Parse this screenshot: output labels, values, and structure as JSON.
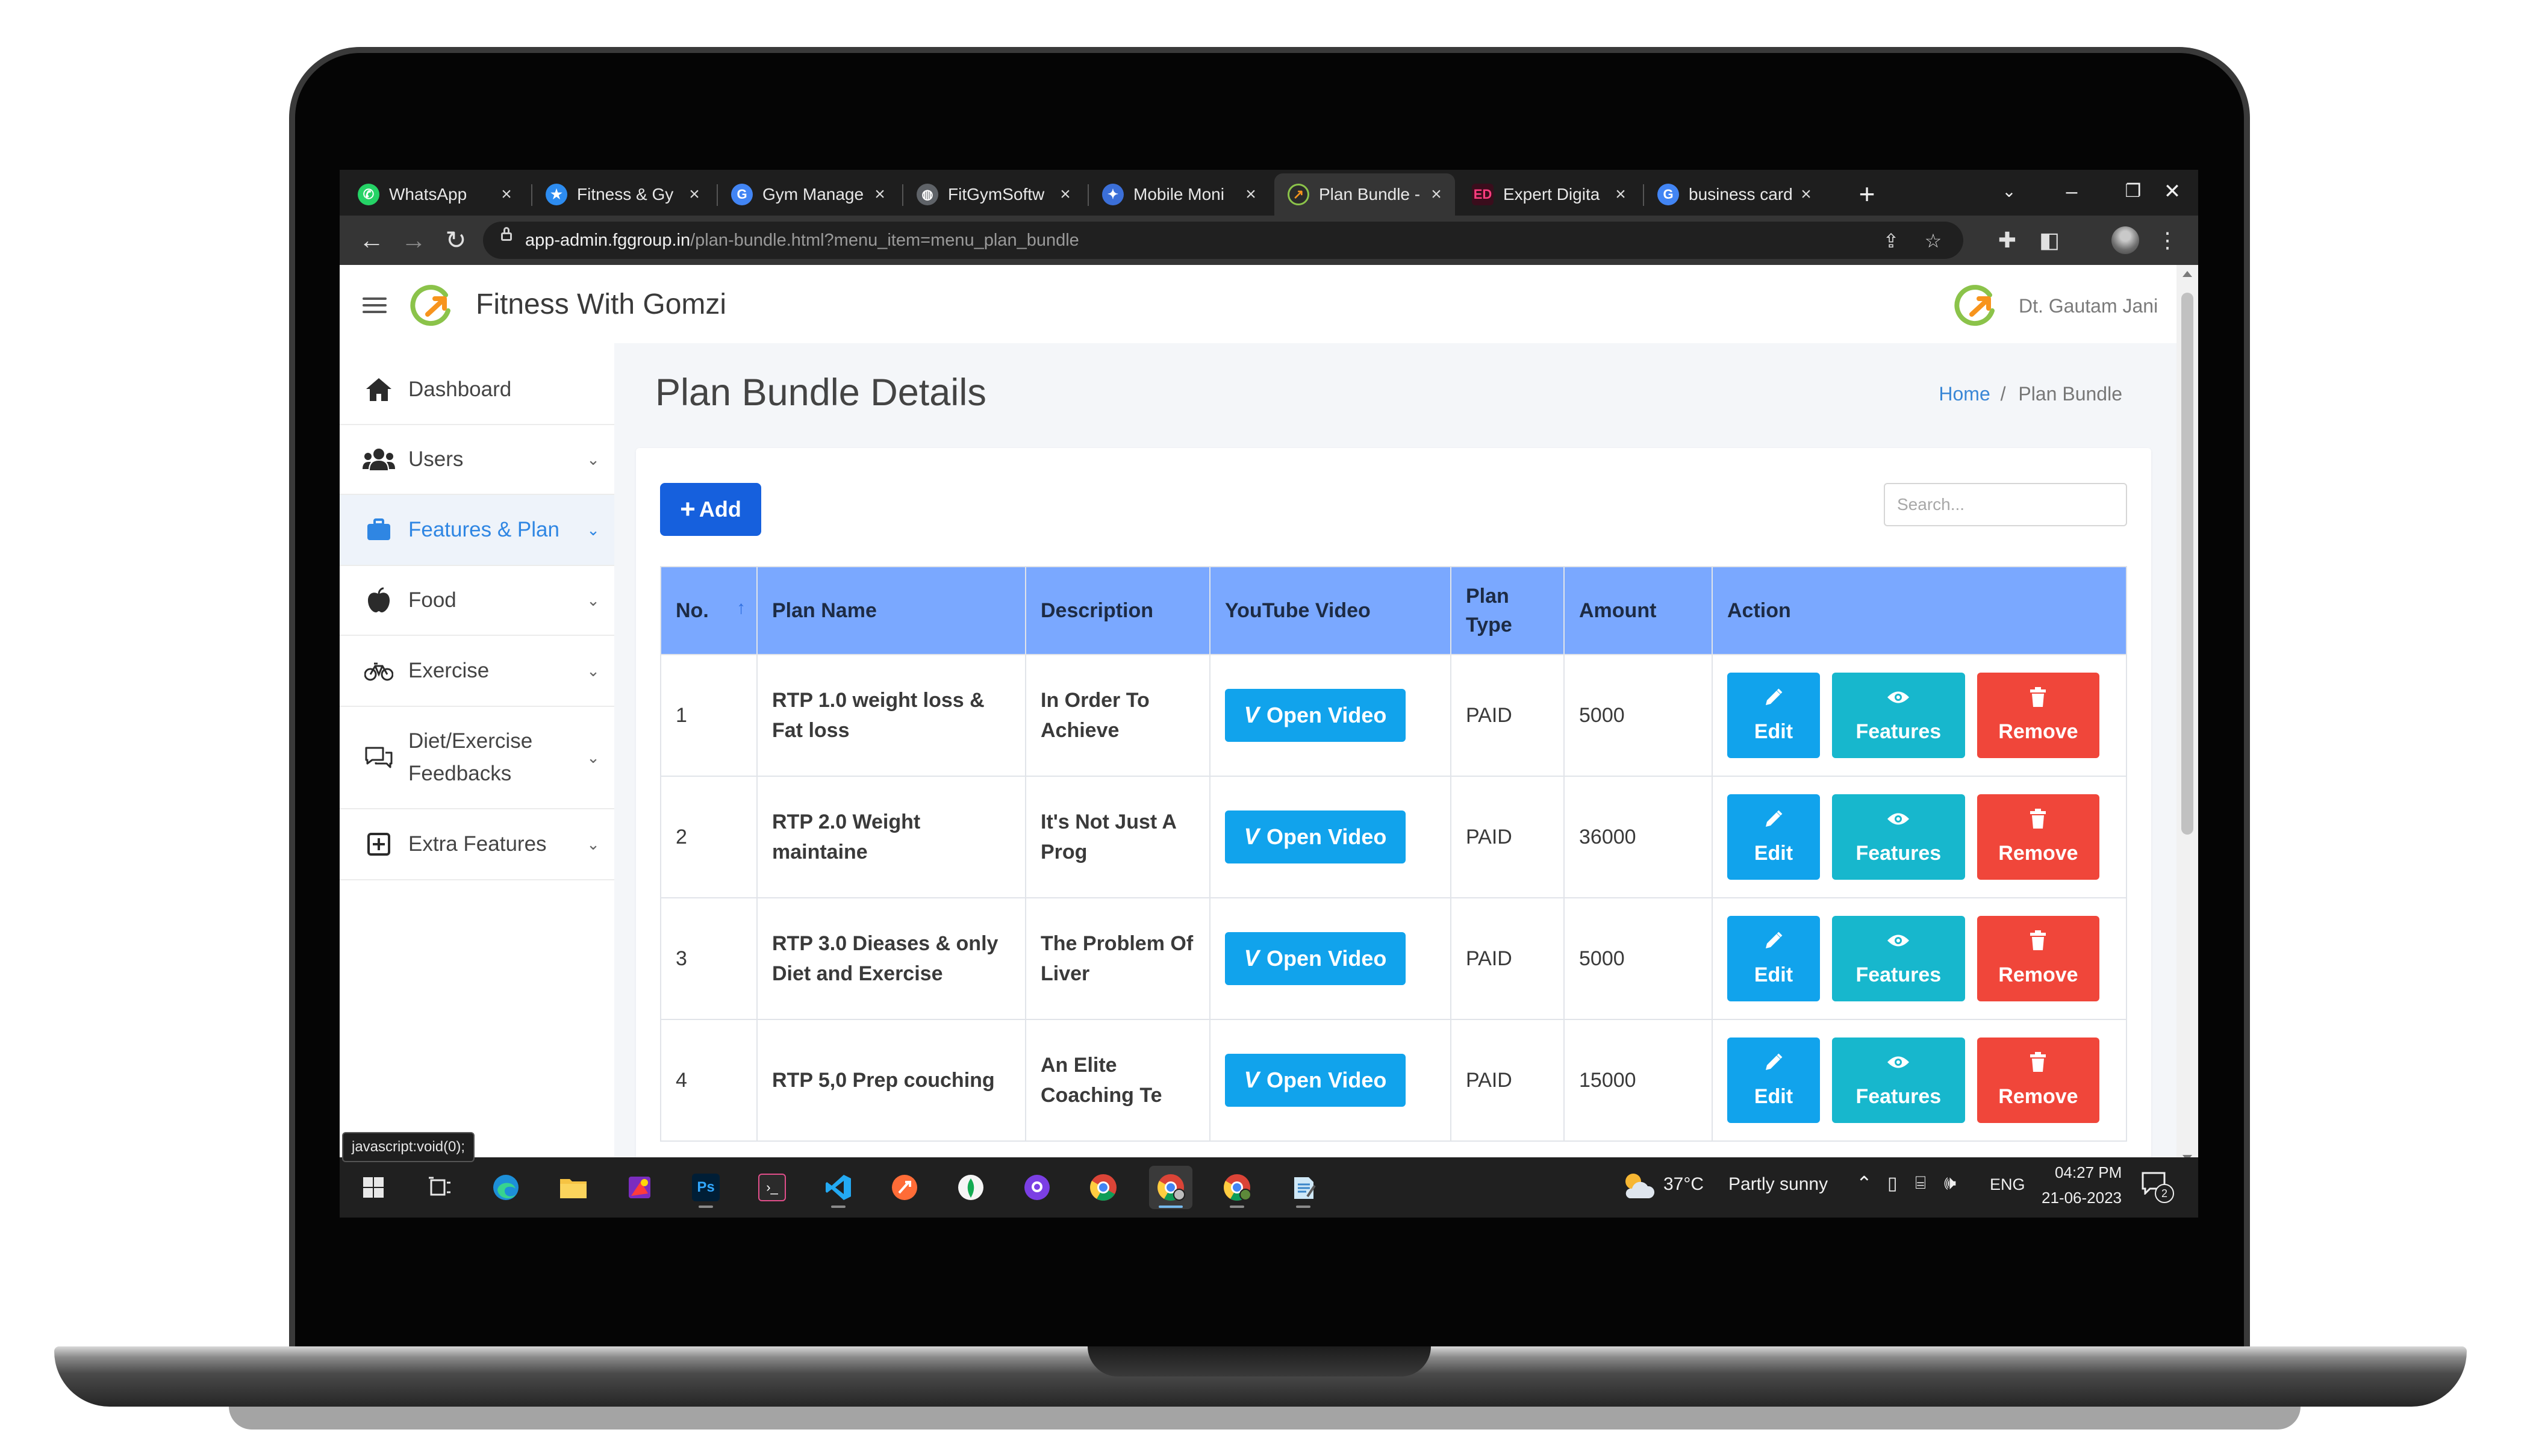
{
  "browser": {
    "tabs": [
      {
        "label": "WhatsApp",
        "icon": "whatsapp-icon",
        "color": "#25d366"
      },
      {
        "label": "Fitness & Gy",
        "icon": "star-badge-icon",
        "color": "#2d8cf0"
      },
      {
        "label": "Gym Manage",
        "icon": "google-icon",
        "color": "#4285f4"
      },
      {
        "label": "FitGymSoftw",
        "icon": "globe-icon",
        "color": "#9aa0a6"
      },
      {
        "label": "Mobile Moni",
        "icon": "shield-icon",
        "color": "#3b6fd8"
      },
      {
        "label": "Plan Bundle -",
        "icon": "gomzi-logo-icon",
        "color": "#8bc34a"
      },
      {
        "label": "Expert Digita",
        "icon": "ed-logo-icon",
        "color": "#d81b60"
      },
      {
        "label": "business card",
        "icon": "google-icon",
        "color": "#4285f4"
      }
    ],
    "address_host": "app-admin.fggroup.in",
    "address_path": "/plan-bundle.html?menu_item=menu_plan_bundle",
    "status_url": "javascript:void(0);"
  },
  "app": {
    "brand": "Fitness With Gomzi",
    "user_name": "Dt. Gautam Jani",
    "accent": "#1660dd"
  },
  "sidebar": {
    "items": [
      {
        "label": "Dashboard",
        "icon": "home-icon",
        "has_submenu": false
      },
      {
        "label": "Users",
        "icon": "users-icon",
        "has_submenu": true
      },
      {
        "label": "Features & Plan",
        "icon": "briefcase-icon",
        "has_submenu": true,
        "active": true
      },
      {
        "label": "Food",
        "icon": "apple-icon",
        "has_submenu": true
      },
      {
        "label": "Exercise",
        "icon": "bicycle-icon",
        "has_submenu": true
      },
      {
        "label": "Diet/Exercise Feedbacks",
        "icon": "comments-icon",
        "has_submenu": true
      },
      {
        "label": "Extra Features",
        "icon": "plus-square-icon",
        "has_submenu": true
      }
    ]
  },
  "page": {
    "title": "Plan Bundle Details",
    "breadcrumb_home": "Home",
    "breadcrumb_sep": "/",
    "breadcrumb_current": "Plan Bundle",
    "add_label": "Add",
    "search_placeholder": "Search..."
  },
  "table": {
    "headers": [
      "No.",
      "Plan Name",
      "Description",
      "YouTube Video",
      "Plan Type",
      "Amount",
      "Action"
    ],
    "video_label": "Open Video",
    "edit_label": "Edit",
    "features_label": "Features",
    "remove_label": "Remove",
    "rows": [
      {
        "no": "1",
        "plan_name": "RTP 1.0 weight loss & Fat loss",
        "description": "In Order To Achieve",
        "plan_type": "PAID",
        "amount": "5000"
      },
      {
        "no": "2",
        "plan_name": "RTP 2.0 Weight maintaine",
        "description": "It's Not Just A Prog",
        "plan_type": "PAID",
        "amount": "36000"
      },
      {
        "no": "3",
        "plan_name": "RTP 3.0 Dieases & only Diet and Exercise",
        "description": "The Problem Of Liver",
        "plan_type": "PAID",
        "amount": "5000"
      },
      {
        "no": "4",
        "plan_name": "RTP 5,0 Prep couching",
        "description": "An Elite Coaching Te",
        "plan_type": "PAID",
        "amount": "15000"
      }
    ]
  },
  "taskbar": {
    "weather_temp": "37°C",
    "weather_text": "Partly sunny",
    "language": "ENG",
    "time": "04:27 PM",
    "date": "21-06-2023",
    "notification_count": "2"
  }
}
